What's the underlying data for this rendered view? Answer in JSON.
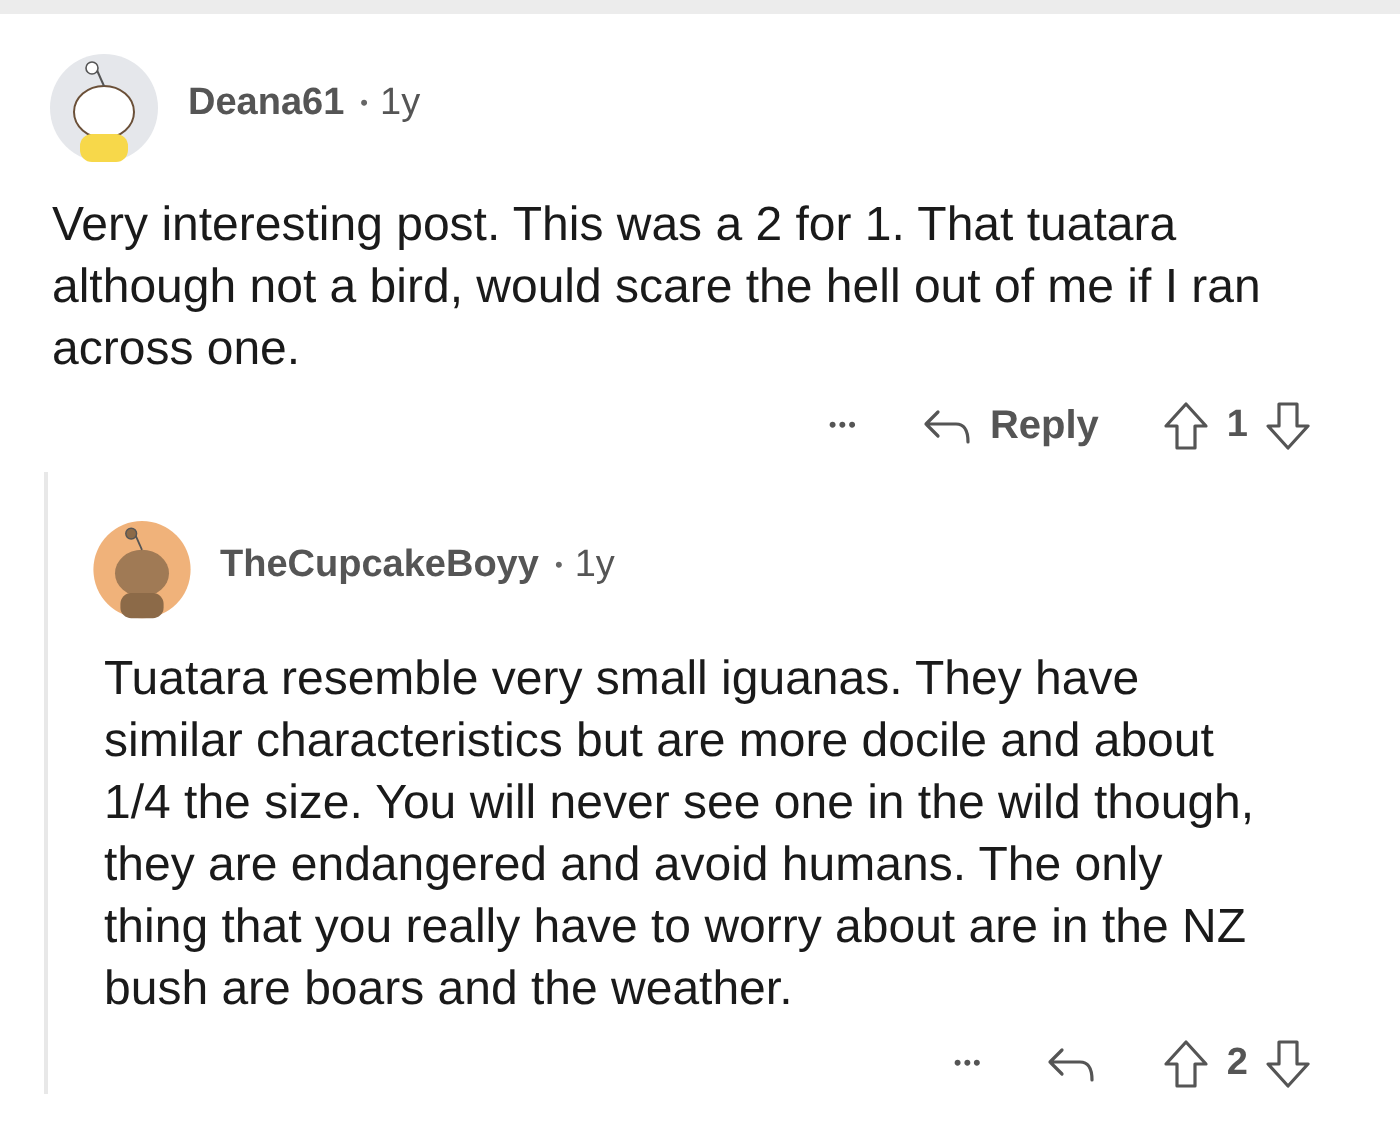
{
  "comments": [
    {
      "author": "Deana61",
      "separator": "•",
      "age": "1y",
      "body": "Very interesting post. This was a 2 for 1. That tuatara although not a bird, would scare the hell out of me if I ran across one.",
      "more": "•••",
      "reply_label": "Reply",
      "score": "1",
      "children": [
        {
          "author": "TheCupcakeBoyy",
          "separator": "•",
          "age": "1y",
          "body": "Tuatara resemble very small iguanas. They have similar characteristics but are more docile and about 1/4 the size. You will never see one in the wild though, they are endangered and avoid humans. The only thing that you really have to worry about are in the NZ bush are boars and the weather.",
          "more": "•••",
          "score": "2"
        }
      ]
    }
  ]
}
